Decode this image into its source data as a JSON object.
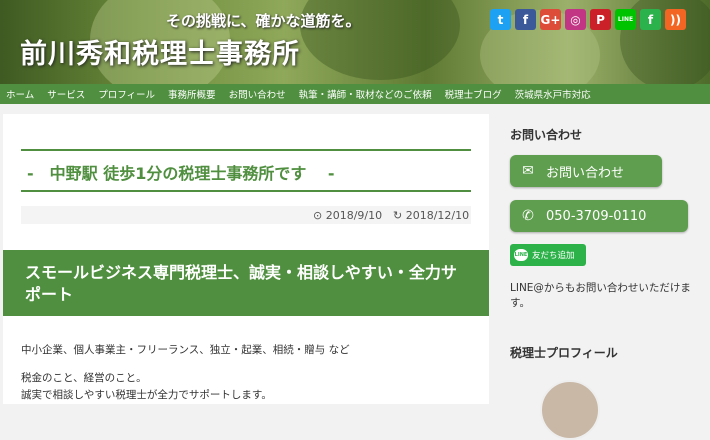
{
  "header": {
    "tagline": "その挑戦に、確かな道筋を。",
    "site_title": "前川秀和税理士事務所",
    "social_icons": [
      {
        "name": "twitter-icon",
        "glyph": "t",
        "color": "#1da1f2"
      },
      {
        "name": "facebook-icon",
        "glyph": "f",
        "color": "#3b5998"
      },
      {
        "name": "google-plus-icon",
        "glyph": "G+",
        "color": "#dd4b39"
      },
      {
        "name": "instagram-icon",
        "glyph": "◎",
        "color": "#c13584"
      },
      {
        "name": "pinterest-icon",
        "glyph": "P",
        "color": "#cb2027"
      },
      {
        "name": "line-icon",
        "glyph": "LINE",
        "color": "#00c300"
      },
      {
        "name": "feedly-icon",
        "glyph": "f",
        "color": "#2bb24c"
      },
      {
        "name": "rss-icon",
        "glyph": "))",
        "color": "#f26522"
      }
    ]
  },
  "nav": {
    "items": [
      "ホーム",
      "サービス",
      "プロフィール",
      "事務所概要",
      "お問い合わせ",
      "執筆・講師・取材などのご依頼",
      "税理士ブログ",
      "茨城県水戸市対応"
    ]
  },
  "main": {
    "heading": "-　中野駅 徒歩1分の税理士事務所です　 -",
    "published_date": "2018/9/10",
    "updated_date": "2018/12/10",
    "section_title": "スモールビジネス専門税理士、誠実・相談しやすい・全力サポート",
    "body_lines": [
      "中小企業、個人事業主・フリーランス、独立・起業、相続・贈与 など",
      "税金のこと、経営のこと。",
      "誠実で相談しやすい税理士が全力でサポートします。"
    ]
  },
  "sidebar": {
    "contact_title": "お問い合わせ",
    "contact_button_label": "お問い合わせ",
    "phone_button_label": "050-3709-0110",
    "line_badge_label": "友だち追加",
    "line_text": "LINE@からもお問い合わせいただけます。",
    "profile_title": "税理士プロフィール"
  },
  "colors": {
    "accent_green": "#4f8f3f",
    "button_green": "#5f9e4f",
    "line_green": "#2db24a"
  }
}
